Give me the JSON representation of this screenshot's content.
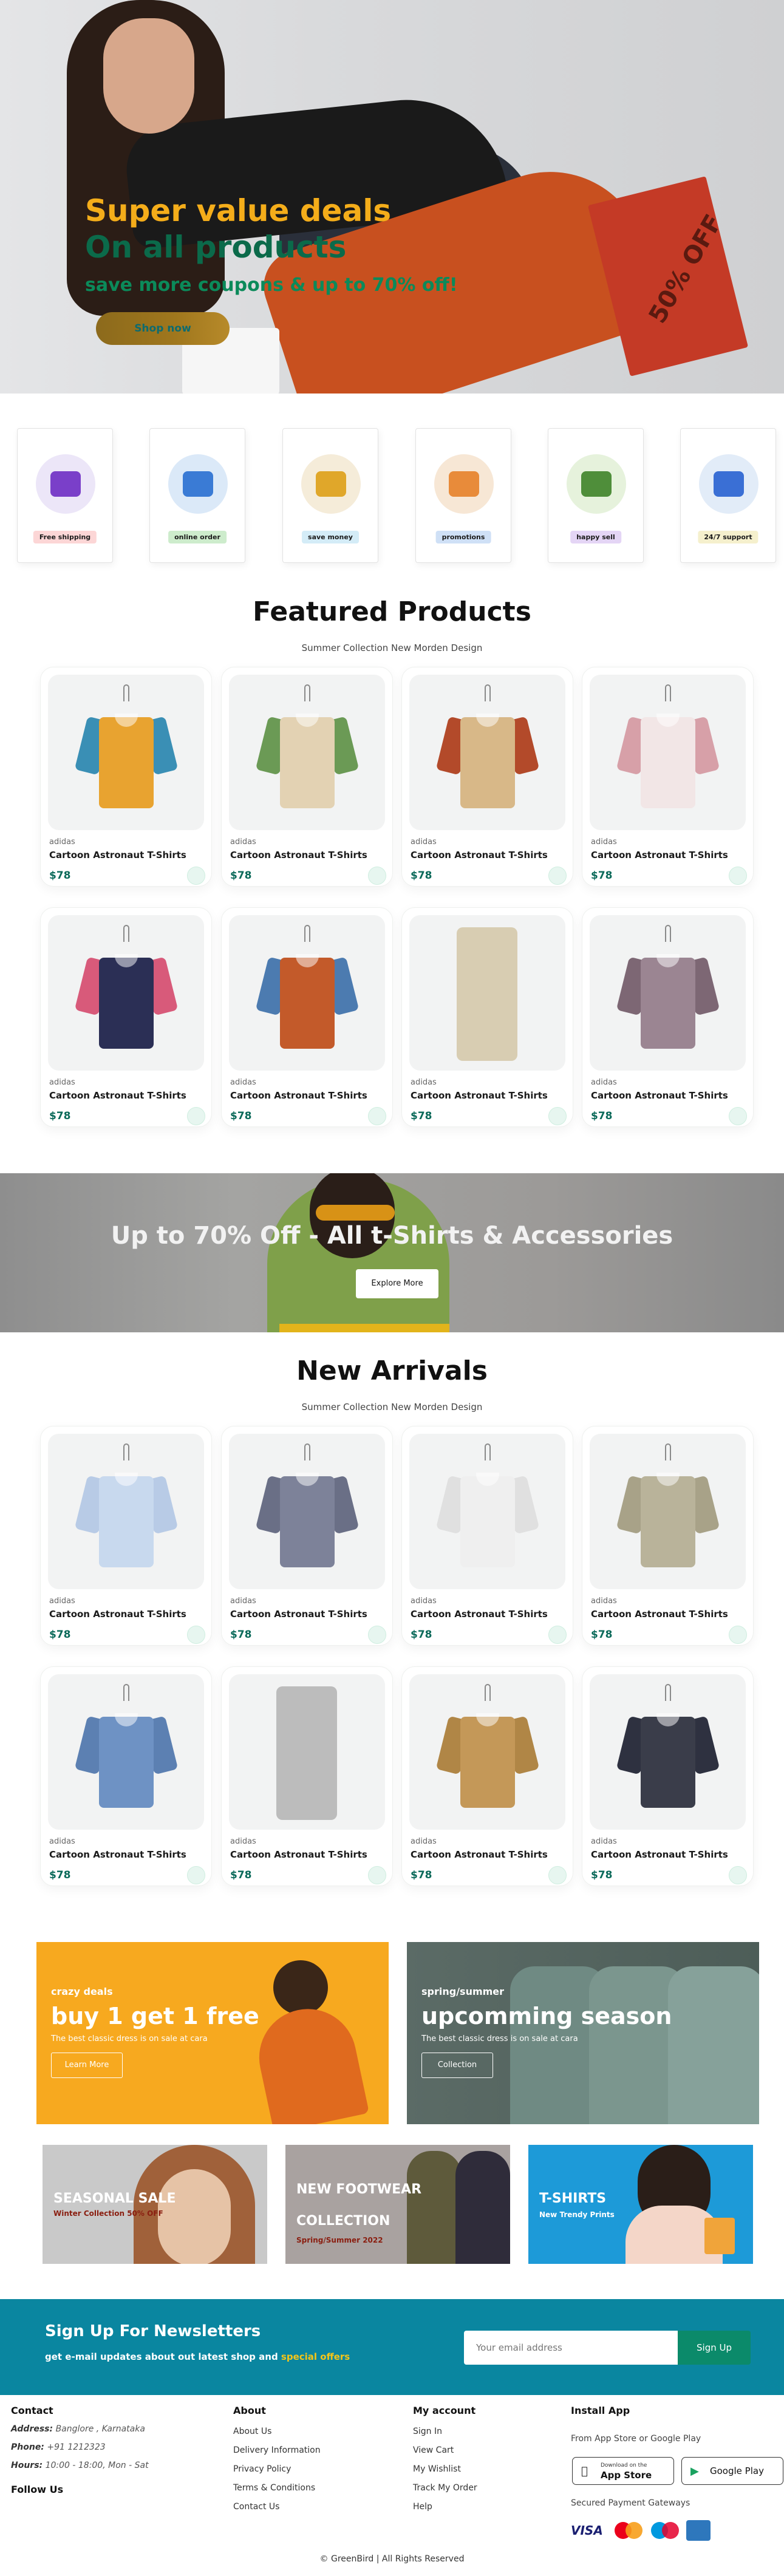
{
  "hero": {
    "title_line1": "Super value deals",
    "title_line2": "On all products",
    "subtitle": "save more coupons & up to 70% off!",
    "shop_button": "Shop now",
    "bag_text": "50% OFF"
  },
  "features": [
    {
      "label": "Free shipping",
      "color": "#fcd6d6",
      "icon": "truck-icon"
    },
    {
      "label": "online order",
      "color": "#cdeccc",
      "icon": "phone-order-icon"
    },
    {
      "label": "save money",
      "color": "#d4ecf7",
      "icon": "money-icon"
    },
    {
      "label": "promotions",
      "color": "#cfe0f6",
      "icon": "promotion-icon"
    },
    {
      "label": "happy sell",
      "color": "#e4d5f5",
      "icon": "happy-sell-icon"
    },
    {
      "label": "24/7 support",
      "color": "#f5f0cd",
      "icon": "support-icon"
    }
  ],
  "featured": {
    "title": "Featured Products",
    "subtitle": "Summer Collection New Morden Design",
    "products": [
      {
        "brand": "adidas",
        "name": "Cartoon Astronaut T-Shirts",
        "price": "$78"
      },
      {
        "brand": "adidas",
        "name": "Cartoon Astronaut T-Shirts",
        "price": "$78"
      },
      {
        "brand": "adidas",
        "name": "Cartoon Astronaut T-Shirts",
        "price": "$78"
      },
      {
        "brand": "adidas",
        "name": "Cartoon Astronaut T-Shirts",
        "price": "$78"
      },
      {
        "brand": "adidas",
        "name": "Cartoon Astronaut T-Shirts",
        "price": "$78"
      },
      {
        "brand": "adidas",
        "name": "Cartoon Astronaut T-Shirts",
        "price": "$78"
      },
      {
        "brand": "adidas",
        "name": "Cartoon Astronaut T-Shirts",
        "price": "$78"
      },
      {
        "brand": "adidas",
        "name": "Cartoon Astronaut T-Shirts",
        "price": "$78"
      }
    ]
  },
  "banner": {
    "title": "Up to 70% Off - All t-Shirts & Accessories",
    "button": "Explore More"
  },
  "arrivals": {
    "title": "New Arrivals",
    "subtitle": "Summer Collection New Morden Design",
    "products": [
      {
        "brand": "adidas",
        "name": "Cartoon Astronaut T-Shirts",
        "price": "$78"
      },
      {
        "brand": "adidas",
        "name": "Cartoon Astronaut T-Shirts",
        "price": "$78"
      },
      {
        "brand": "adidas",
        "name": "Cartoon Astronaut T-Shirts",
        "price": "$78"
      },
      {
        "brand": "adidas",
        "name": "Cartoon Astronaut T-Shirts",
        "price": "$78"
      },
      {
        "brand": "adidas",
        "name": "Cartoon Astronaut T-Shirts",
        "price": "$78"
      },
      {
        "brand": "adidas",
        "name": "Cartoon Astronaut T-Shirts",
        "price": "$78"
      },
      {
        "brand": "adidas",
        "name": "Cartoon Astronaut T-Shirts",
        "price": "$78"
      },
      {
        "brand": "adidas",
        "name": "Cartoon Astronaut T-Shirts",
        "price": "$78"
      }
    ]
  },
  "promos": [
    {
      "tag": "crazy deals",
      "title": "buy 1 get 1 free",
      "desc": "The best classic dress is on sale at cara",
      "button": "Learn More"
    },
    {
      "tag": "spring/summer",
      "title": "upcomming season",
      "desc": "The best classic dress is on sale at cara",
      "button": "Collection"
    }
  ],
  "minis": [
    {
      "title": "SEASONAL SALE",
      "sub": "Winter Collection 50% OFF"
    },
    {
      "title": "NEW FOOTWEAR COLLECTION",
      "sub": "Spring/Summer 2022"
    },
    {
      "title": "T-SHIRTS",
      "sub": "New Trendy Prints"
    }
  ],
  "newsletter": {
    "title": "Sign Up For Newsletters",
    "text": "get e-mail updates about out latest shop and",
    "highlight": "special offers",
    "placeholder": "Your email address",
    "button": "Sign Up"
  },
  "footer": {
    "contact": {
      "title": "Contact",
      "address_label": "Address:",
      "address": "Banglore , Karnataka",
      "phone_label": "Phone:",
      "phone": "+91 1212323",
      "hours_label": "Hours:",
      "hours": "10:00 - 18:00, Mon - Sat",
      "follow": "Follow Us"
    },
    "about": {
      "title": "About",
      "links": [
        "About Us",
        "Delivery Information",
        "Privacy Policy",
        "Terms & Conditions",
        "Contact Us"
      ]
    },
    "account": {
      "title": "My account",
      "links": [
        "Sign In",
        "View Cart",
        "My Wishlist",
        "Track My Order",
        "Help"
      ]
    },
    "install": {
      "title": "Install App",
      "from": "From App Store or Google Play",
      "appstore_small": "Download on the",
      "appstore": "App Store",
      "googleplay": "Google Play",
      "secured": "Secured Payment Gateways",
      "payments": [
        "VISA",
        "MasterCard",
        "Maestro",
        "AMEX"
      ]
    },
    "copyright": "© GreenBird | All Rights Reserved"
  }
}
